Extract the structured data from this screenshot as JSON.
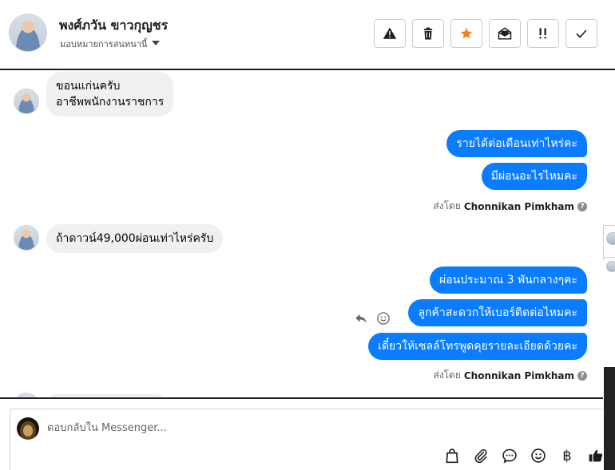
{
  "header": {
    "contact_name": "พงศ์ภวัน ขาวกุญชร",
    "assign_label": "มอบหมายการสนทนานี้",
    "actions": [
      {
        "name": "spam-button",
        "icon": "warning-icon"
      },
      {
        "name": "delete-button",
        "icon": "trash-icon"
      },
      {
        "name": "star-button",
        "icon": "star-icon",
        "color": "#f5821f"
      },
      {
        "name": "mark-unread-button",
        "icon": "envelope-open-icon"
      },
      {
        "name": "follow-up-button",
        "icon": "exclamation-icon"
      },
      {
        "name": "done-button",
        "icon": "check-icon"
      }
    ]
  },
  "messages": {
    "in_1_line1": "ขอนแก่นครับ",
    "in_1_line2": "อาชีพพนักงานราชการ",
    "out_1": "รายได้ต่อเดือนเท่าไหร่คะ",
    "out_2": "มีผ่อนอะไรไหมคะ",
    "sent_by_1_prefix": "ส่งโดย",
    "sent_by_1_name": "Chonnikan Pimkham",
    "in_2": "ถ้าดาวน์49,000ผ่อนเท่าไหร่ครับ",
    "out_3": "ผ่อนประมาณ 3 พันกลางๆคะ",
    "out_4": "ลูกค้าสะดวกให้เบอร์ติดต่อไหมคะ",
    "out_5": "เดี๋ยวให้เซลล์โทรพูดคุยรายละเอียดด้วยคะ",
    "sent_by_2_prefix": "ส่งโดย",
    "sent_by_2_name": "Chonnikan Pimkham"
  },
  "composer": {
    "placeholder": "ตอบกลับใน Messenger...",
    "tools": [
      "bag-icon",
      "paperclip-icon",
      "chat-bubble-icon",
      "smiley-icon",
      "baht-icon",
      "thumbs-up-icon"
    ],
    "baht_symbol": "฿"
  },
  "colors": {
    "outgoing_bubble": "#0a7cff",
    "incoming_bubble": "#f0f0f0",
    "star_accent": "#f5821f"
  }
}
